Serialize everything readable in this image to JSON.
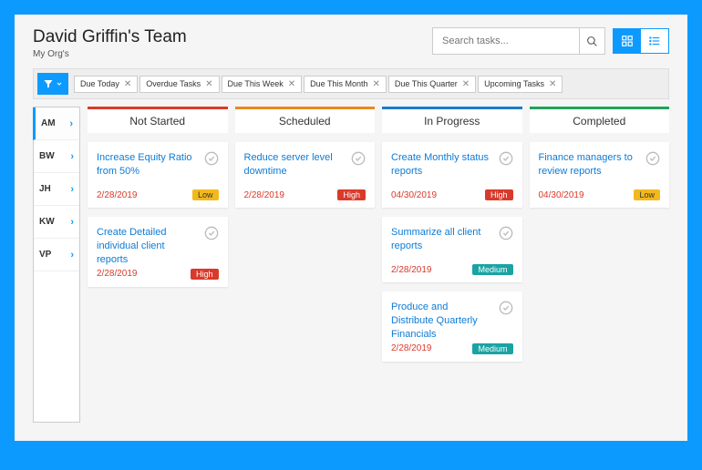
{
  "header": {
    "title": "David Griffin's Team",
    "subtitle": "My Org's",
    "search_placeholder": "Search tasks..."
  },
  "filters": [
    {
      "label": "Due Today"
    },
    {
      "label": "Overdue Tasks"
    },
    {
      "label": "Due This Week"
    },
    {
      "label": "Due This Month"
    },
    {
      "label": "Due This Quarter"
    },
    {
      "label": "Upcoming Tasks"
    }
  ],
  "people": [
    {
      "initials": "AM",
      "active": true
    },
    {
      "initials": "BW",
      "active": false
    },
    {
      "initials": "JH",
      "active": false
    },
    {
      "initials": "KW",
      "active": false
    },
    {
      "initials": "VP",
      "active": false
    }
  ],
  "columns": [
    {
      "name": "Not Started",
      "color": "red",
      "cards": [
        {
          "title": "Increase Equity Ratio from 50%",
          "date": "2/28/2019",
          "priority": "Low"
        },
        {
          "title": "Create Detailed individual client reports",
          "date": "2/28/2019",
          "priority": "High"
        }
      ]
    },
    {
      "name": "Scheduled",
      "color": "orange",
      "cards": [
        {
          "title": "Reduce server level downtime",
          "date": "2/28/2019",
          "priority": "High"
        }
      ]
    },
    {
      "name": "In Progress",
      "color": "blue",
      "cards": [
        {
          "title": "Create Monthly status reports",
          "date": "04/30/2019",
          "priority": "High"
        },
        {
          "title": "Summarize all client reports",
          "date": "2/28/2019",
          "priority": "Medium"
        },
        {
          "title": "Produce and Distribute Quarterly Financials",
          "date": "2/28/2019",
          "priority": "Medium"
        }
      ]
    },
    {
      "name": "Completed",
      "color": "green",
      "cards": [
        {
          "title": "Finance managers to review reports",
          "date": "04/30/2019",
          "priority": "Low"
        }
      ]
    }
  ]
}
